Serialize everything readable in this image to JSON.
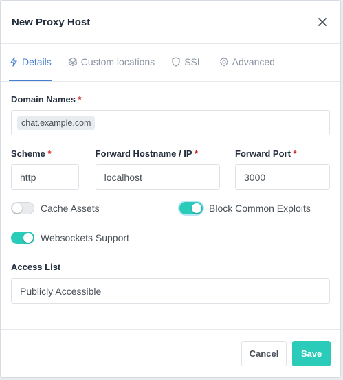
{
  "modal": {
    "title": "New Proxy Host"
  },
  "tabs": [
    {
      "label": "Details",
      "icon": "lightning-icon",
      "active": true
    },
    {
      "label": "Custom locations",
      "icon": "layers-icon",
      "active": false
    },
    {
      "label": "SSL",
      "icon": "shield-icon",
      "active": false
    },
    {
      "label": "Advanced",
      "icon": "gear-icon",
      "active": false
    }
  ],
  "form": {
    "domain_names": {
      "label": "Domain Names",
      "required": "*",
      "chips": [
        "chat.example.com"
      ]
    },
    "scheme": {
      "label": "Scheme",
      "required": "*",
      "value": "http"
    },
    "forward_host": {
      "label": "Forward Hostname / IP",
      "required": "*",
      "value": "localhost"
    },
    "forward_port": {
      "label": "Forward Port",
      "required": "*",
      "value": "3000"
    },
    "cache_assets": {
      "label": "Cache Assets",
      "enabled": false
    },
    "block_exploits": {
      "label": "Block Common Exploits",
      "enabled": true
    },
    "websockets": {
      "label": "Websockets Support",
      "enabled": true
    },
    "access_list": {
      "label": "Access List",
      "value": "Publicly Accessible"
    }
  },
  "footer": {
    "cancel_label": "Cancel",
    "save_label": "Save"
  },
  "colors": {
    "accent": "#2bcbba",
    "tab_active": "#467fcf",
    "required": "#cd201f"
  }
}
